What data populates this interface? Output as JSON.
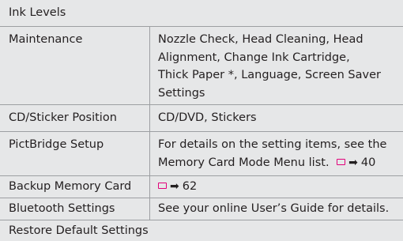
{
  "rows": [
    {
      "name": "Ink Levels",
      "value": ""
    },
    {
      "name": "Maintenance",
      "value_lines": [
        "Nozzle Check, Head Cleaning, Head",
        "Alignment, Change Ink Cartridge,",
        "Thick Paper *, Language, Screen Saver",
        "Settings"
      ]
    },
    {
      "name": "CD/Sticker Position",
      "value": "CD/DVD, Stickers"
    },
    {
      "name": "PictBridge Setup",
      "value_lines": [
        "For details on the setting items, see the",
        "Memory Card Mode Menu list."
      ],
      "ref_page": "40"
    },
    {
      "name": "Backup Memory Card",
      "ref_page": "62"
    },
    {
      "name": "Bluetooth Settings",
      "value": "See your online User’s Guide for details."
    },
    {
      "name": "Restore Default Settings",
      "value": ""
    }
  ],
  "icons": {
    "book": "book-icon",
    "arrow": "arrow-right-icon",
    "arrow_glyph": "➡"
  },
  "colors": {
    "row_bg": "#e6e7e8",
    "divider": "#9d9fa2",
    "icon_accent": "#e2007a",
    "text": "#231f20"
  }
}
